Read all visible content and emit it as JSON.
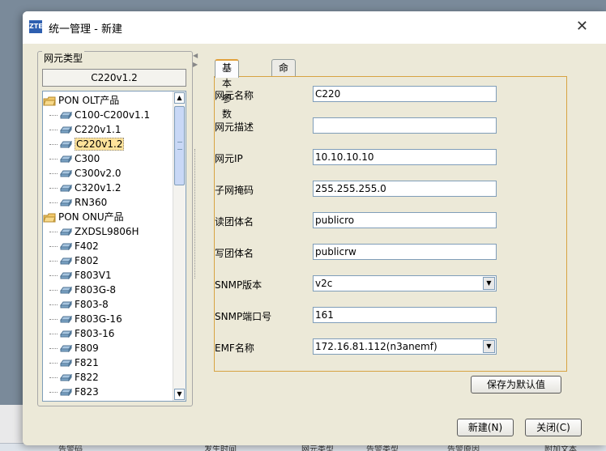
{
  "background": {
    "table_headers": [
      "告警码",
      "发生时间",
      "网元类型",
      "告警类型",
      "告警原因",
      "附加文本"
    ]
  },
  "dialog": {
    "title": "统一管理 - 新建",
    "icon_text": "ZTE",
    "close_icon": "close-icon"
  },
  "left": {
    "legend": "网元类型",
    "selected_type": "C220v1.2",
    "tree": [
      {
        "type": "category",
        "label": "PON OLT产品"
      },
      {
        "type": "leaf",
        "label": "C100-C200v1.1"
      },
      {
        "type": "leaf",
        "label": "C220v1.1"
      },
      {
        "type": "leaf",
        "label": "C220v1.2",
        "selected": true
      },
      {
        "type": "leaf",
        "label": "C300"
      },
      {
        "type": "leaf",
        "label": "C300v2.0"
      },
      {
        "type": "leaf",
        "label": "C320v1.2"
      },
      {
        "type": "leaf",
        "label": "RN360"
      },
      {
        "type": "category",
        "label": "PON ONU产品"
      },
      {
        "type": "leaf",
        "label": "ZXDSL9806H"
      },
      {
        "type": "leaf",
        "label": "F402"
      },
      {
        "type": "leaf",
        "label": "F802"
      },
      {
        "type": "leaf",
        "label": "F803V1"
      },
      {
        "type": "leaf",
        "label": "F803G-8"
      },
      {
        "type": "leaf",
        "label": "F803-8"
      },
      {
        "type": "leaf",
        "label": "F803G-16"
      },
      {
        "type": "leaf",
        "label": "F803-16"
      },
      {
        "type": "leaf",
        "label": "F809"
      },
      {
        "type": "leaf",
        "label": "F821"
      },
      {
        "type": "leaf",
        "label": "F822"
      },
      {
        "type": "leaf",
        "label": "F823"
      }
    ]
  },
  "tabs": [
    {
      "label": "基本参数",
      "active": true
    },
    {
      "label": "命令行参数",
      "active": false
    }
  ],
  "form": {
    "fields": [
      {
        "label": "网元名称",
        "value": "C220",
        "kind": "text"
      },
      {
        "label": "网元描述",
        "value": "",
        "kind": "text"
      },
      {
        "label": "网元IP",
        "value": "10.10.10.10",
        "kind": "text"
      },
      {
        "label": "子网掩码",
        "value": "255.255.255.0",
        "kind": "text"
      },
      {
        "label": "读团体名",
        "value": "publicro",
        "kind": "text"
      },
      {
        "label": "写团体名",
        "value": "publicrw",
        "kind": "text"
      },
      {
        "label": "SNMP版本",
        "value": "v2c",
        "kind": "select"
      },
      {
        "label": "SNMP端口号",
        "value": "161",
        "kind": "text"
      },
      {
        "label": "EMF名称",
        "value": "172.16.81.112(n3anemf)",
        "kind": "select"
      }
    ],
    "save_default_label": "保存为默认值"
  },
  "buttons": {
    "new_label": "新建(N)",
    "close_label": "关闭(C)"
  },
  "colors": {
    "dialog_bg": "#ece9d8",
    "tab_accent": "#e2a13c",
    "selection": "#ffe39b"
  }
}
